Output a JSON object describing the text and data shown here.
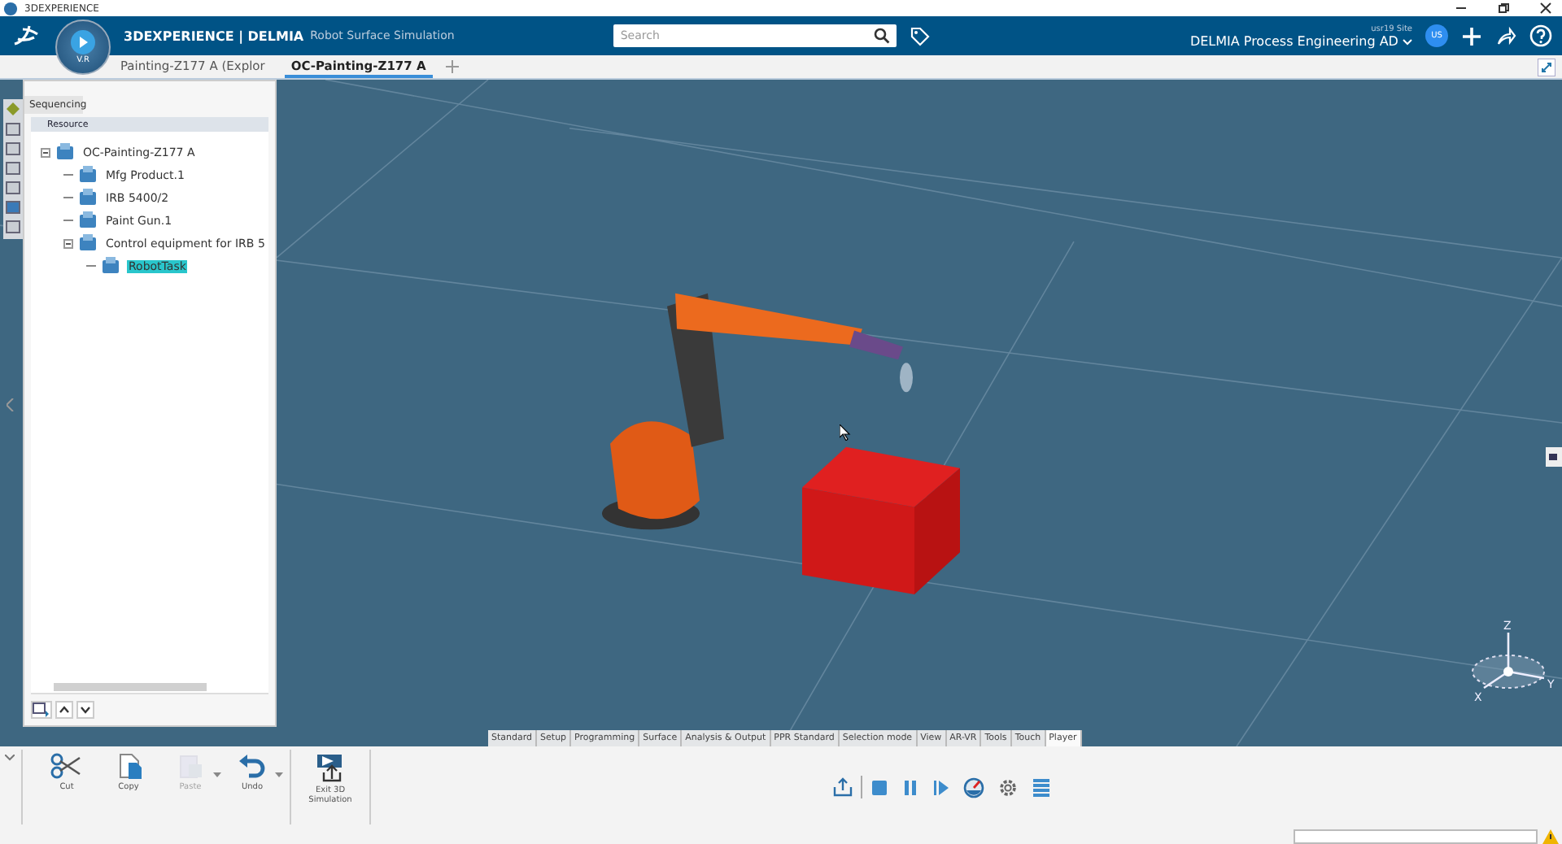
{
  "window": {
    "title": "3DEXPERIENCE"
  },
  "top_bar": {
    "brand": "3DEXPERIENCE | DELMIA",
    "subtitle": "Robot Surface Simulation",
    "compass_label": "V.R",
    "search": {
      "placeholder": "Search"
    },
    "site": "usr19 Site",
    "role": "DELMIA Process Engineering AD",
    "avatar": "US"
  },
  "doc_tabs": [
    {
      "label": "Painting-Z177 A (Explor",
      "selected": false
    },
    {
      "label": "OC-Painting-Z177 A",
      "selected": true
    }
  ],
  "panel": {
    "tab": "Sequencing",
    "header": "Resource",
    "tree": [
      {
        "label": "OC-Painting-Z177 A",
        "selected": false,
        "expanded": true,
        "children": [
          {
            "label": "Mfg Product.1",
            "selected": false
          },
          {
            "label": "IRB 5400/2",
            "selected": false
          },
          {
            "label": "Paint Gun.1",
            "selected": false
          },
          {
            "label": "Control equipment for IRB 5",
            "selected": false,
            "expanded": true,
            "children": [
              {
                "label": "RobotTask",
                "selected": true
              }
            ]
          }
        ]
      }
    ]
  },
  "compass_axes": [
    "X",
    "Y",
    "Z"
  ],
  "ribbon_tabs": [
    {
      "label": "Standard",
      "selected": false
    },
    {
      "label": "Setup",
      "selected": false
    },
    {
      "label": "Programming",
      "selected": false
    },
    {
      "label": "Surface",
      "selected": false
    },
    {
      "label": "Analysis & Output",
      "selected": false
    },
    {
      "label": "PPR Standard",
      "selected": false
    },
    {
      "label": "Selection mode",
      "selected": false
    },
    {
      "label": "View",
      "selected": false
    },
    {
      "label": "AR-VR",
      "selected": false
    },
    {
      "label": "Tools",
      "selected": false
    },
    {
      "label": "Touch",
      "selected": false
    },
    {
      "label": "Player",
      "selected": true
    }
  ],
  "commands": [
    {
      "label": "Cut",
      "kind": "cut",
      "disabled": false,
      "menu": false
    },
    {
      "label": "Copy",
      "kind": "copy",
      "disabled": false,
      "menu": false
    },
    {
      "label": "Paste",
      "kind": "paste",
      "disabled": true,
      "menu": true
    },
    {
      "label": "Undo",
      "kind": "undo",
      "disabled": false,
      "menu": true
    }
  ],
  "exit_command": {
    "label": "Exit 3D Simulation"
  }
}
